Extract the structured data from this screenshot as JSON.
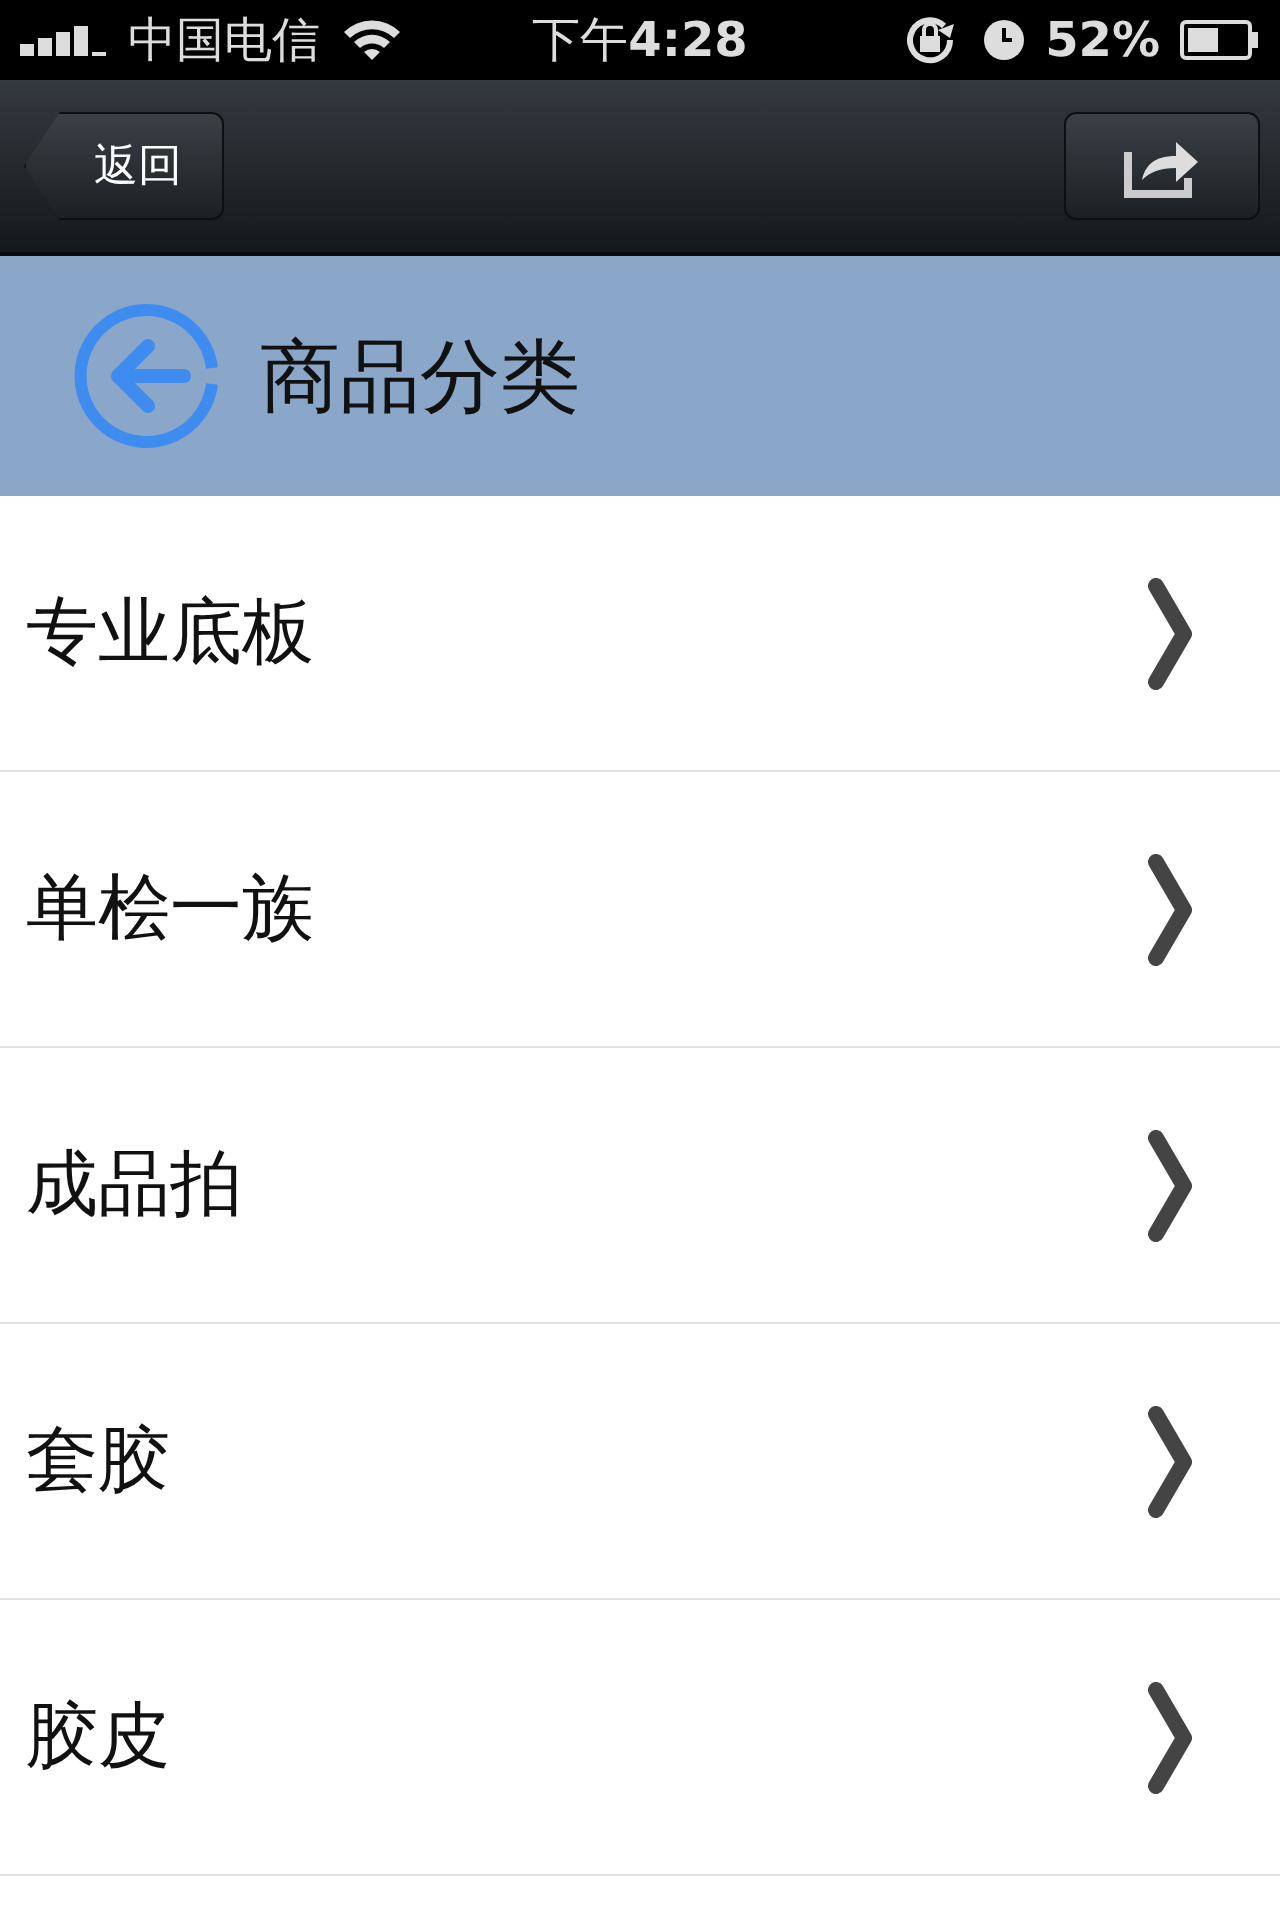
{
  "status_bar": {
    "carrier": "中国电信",
    "time_prefix": "下午",
    "time": "4:28",
    "battery": "52%"
  },
  "nav_bar": {
    "back": "返回"
  },
  "header": {
    "title": "商品分类"
  },
  "categories": [
    {
      "label": "专业底板"
    },
    {
      "label": "单桧一族"
    },
    {
      "label": "成品拍"
    },
    {
      "label": "套胶"
    },
    {
      "label": "胶皮"
    }
  ]
}
